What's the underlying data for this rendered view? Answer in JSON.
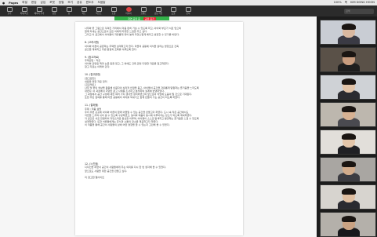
{
  "menubar": {
    "app_name": "Pages",
    "items": [
      "파일",
      "편집",
      "삽입",
      "포맷",
      "정렬",
      "보기",
      "공유",
      "윈도우",
      "도움말"
    ],
    "right_status": [
      "100%",
      "목",
      "KIM DONG HOON"
    ]
  },
  "toolbar": {
    "buttons": [
      "보기",
      "확대/축소",
      "페이지 추가",
      "삽입",
      "표",
      "차트",
      "텍스트",
      "도형",
      "미디어",
      "코멘트",
      "공동 작업",
      "포맷",
      "문서"
    ],
    "share_label": "화면 공유 중",
    "search_placeholder": "검색"
  },
  "share_bar": {
    "label": "화면 공유 중",
    "stop_label": "공유 중지"
  },
  "document": {
    "lines_top": [
      "나무와 꽃 그림으로 꾸며진 거리에서 마음 편히 거닐 수 있도록 하고, 아이와 부모가 서로 믿으며",
      "함께 지내는 공간으로서 모든 이에게 따뜻한 느낌을 주고 싶다.",
      "그리고 이 공간에서 아이들이 자유롭게 뛰어 놀며 자연스럽게 배우고 성장할 수 있기를 바란다."
    ],
    "section8_title": "8. (고려사항)",
    "section8_lines": [
      "아이와 어른이 공존하는 주택을 설계하고자 한다. 마을의 공동체 의식을 살리는 방향으로 건축",
      "공간을 계획하고 주변 환경과 조화를 이루도록 한다."
    ],
    "section9_title": "9. (참고자료)",
    "section9_lines": [
      "주제관련 : 직관",
      "아이와 관련된 책과 논문 등을 읽고, 그 외에도 건축 관련 다양한 자료를 참고하였다.",
      "참고 자료는 아래와 같다."
    ],
    "section10_title": "10. (참고문헌)",
    "section10_lines": [
      "(참고문헌)",
      "내용을 위한 자료 정리",
      "",
      "(프로젝트)",
      "나무 및 꽃의 색상을 활용해 이용자의 심리적 안정을 돕고, 아이들이 공간을 자유롭게 탐험하는 즐거움을 느끼도록",
      "하였다. 이 과정에서 다양한 참고 사례를 조사하고 분석하여 설계에 반영하였다.",
      "그 과정에서 공간 구성에 대한 여러 가지 생각을 정리하였으며 앞으로의 작업에 도움이 될 것으로 기대된다.",
      "또한 주민 참여를 통해 마을 공동체의 의미를 되새기고 함께 만들어 가는 공간이 되도록 하였다."
    ],
    "section11_title": "11. (결과물)",
    "section11_lines": [
      "주제 : 작품 설명",
      "",
      "우리 주변 곳곳에 아이와 어른이 함께 어울릴 수 있는 공간을 만들고자 하였다. 도시 속 작은 공간에서도",
      "자연을 느끼며 쉬어 갈 수 있도록 구성하였고, 놀이와 배움이 동시에 이루어지는 장소가 되도록 계획하였다.",
      "각 공간은 서로 연결되어 자연스러운 동선을 이루며, 아이들이 스스로 탐색하고 발견하는 즐거움을 느낄 수 있도록",
      "설계하였다. 또한 어른들에게는 휴식과 소통의 장소를 제공하고자 하였다.",
      "이 작품을 통해 공간이 사람들의 삶에 어떤 영향을 줄 수 있는지 고민해 볼 수 있었다."
    ],
    "section12_title": "12. (느낀점)",
    "section12_lines": [
      "디자인을 하면서 공간이 사람들에게 주는 의미를 다시 한 번 생각해 볼 수 있었다.",
      "앞으로도 사람을 위한 공간을 만들고 싶다."
    ],
    "footer_line": "2) 참고한 웹사이트"
  },
  "participants": [
    {
      "name": "",
      "bg": "#c9cdd4",
      "skin": "#d9b8a0",
      "shirt": "#3a3a44"
    },
    {
      "name": "",
      "bg": "#5a5148",
      "skin": "#c89c7e",
      "shirt": "#1e1e1e"
    },
    {
      "name": "",
      "bg": "#cfd2d6",
      "skin": "#e2c3a7",
      "shirt": "#2b2b30"
    },
    {
      "name": "",
      "bg": "#bdb7ae",
      "skin": "#d6b193",
      "shirt": "#4a4a50"
    },
    {
      "name": "",
      "bg": "#e2dfda",
      "skin": "#e4c6aa",
      "shirt": "#202024"
    },
    {
      "name": "",
      "bg": "#a9a6a2",
      "skin": "#d2ac8c",
      "shirt": "#3c3c42"
    },
    {
      "name": "",
      "bg": "#d7d4cf",
      "skin": "#dfbea0",
      "shirt": "#2a2a30"
    },
    {
      "name": "",
      "bg": "#b4b0aa",
      "skin": "#c9a283",
      "shirt": "#18181c"
    }
  ]
}
